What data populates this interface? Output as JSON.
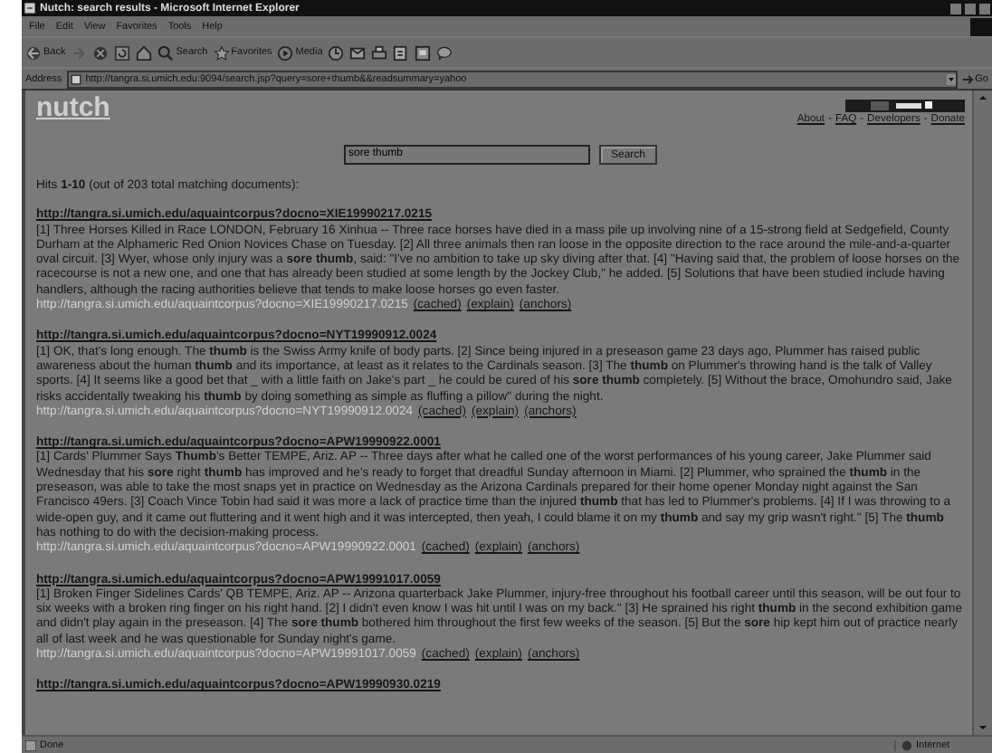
{
  "window": {
    "title": "Nutch: search results - Microsoft Internet Explorer"
  },
  "menu": [
    "File",
    "Edit",
    "View",
    "Favorites",
    "Tools",
    "Help"
  ],
  "toolbar": [
    {
      "kind": "back",
      "label": "Back"
    },
    {
      "kind": "forward"
    },
    {
      "kind": "stop"
    },
    {
      "kind": "refresh"
    },
    {
      "kind": "home"
    },
    {
      "kind": "search",
      "label": "Search"
    },
    {
      "kind": "favorites",
      "label": "Favorites"
    },
    {
      "kind": "media",
      "label": "Media"
    },
    {
      "kind": "history"
    },
    {
      "kind": "mail"
    },
    {
      "kind": "print"
    },
    {
      "kind": "edit"
    },
    {
      "kind": "discuss"
    },
    {
      "kind": "messenger"
    }
  ],
  "address": {
    "label": "Address",
    "value": "http://tangra.si.umich.edu:9094/search.jsp?query=sore+thumb&&readsummary=yahoo",
    "go": "Go"
  },
  "page": {
    "logo": "nutch",
    "nav": [
      {
        "kind": "link",
        "label": "About"
      },
      {
        "kind": "separator",
        "label": "-"
      },
      {
        "kind": "link",
        "label": "FAQ"
      },
      {
        "kind": "separator",
        "label": "-"
      },
      {
        "kind": "link",
        "label": "Developers"
      },
      {
        "kind": "separator",
        "label": "-"
      },
      {
        "kind": "link",
        "label": "Donate"
      }
    ],
    "search": {
      "value": "sore thumb",
      "button": "Search"
    },
    "hits": "Hits **1-10** (out of 203 total matching documents):",
    "results": [
      {
        "title": "http://tangra.si.umich.edu/aquaintcorpus?docno=XIE19990217.0215",
        "snippet": "[1] Three Horses Killed in Race LONDON, February 16 Xinhua -- Three race horses have died in a mass pile up involving nine of a 15-strong field at Sedgefield, County Durham at the Alphameric Red Onion Novices Chase on Tuesday. [2] All three animals then ran loose in the opposite direction to the race around the mile-and-a-quarter oval circuit. [3] Wyer, whose only injury was a **sore thumb**, said: \"I've no ambition to take up sky diving after that. [4] \"Having said that, the problem of loose horses on the racecourse is not a new one, and one that has already been studied at some length by the Jockey Club,\" he added. [5] Solutions that have been studied include having handlers, although the racing authorities believe that tends to make loose horses go even faster.",
        "url": "http://tangra.si.umich.edu/aquaintcorpus?docno=XIE19990217.0215",
        "links": [
          "(cached)",
          "(explain)",
          "(anchors)"
        ]
      },
      {
        "title": "http://tangra.si.umich.edu/aquaintcorpus?docno=NYT19990912.0024",
        "snippet": "[1] OK, that's long enough. The **thumb** is the Swiss Army knife of body parts. [2] Since being injured in a preseason game 23 days ago, Plummer has raised public awareness about the human **thumb** and its importance, at least as it relates to the Cardinals season. [3] The **thumb** on Plummer's throwing hand is the talk of Valley sports. [4] It seems like a good bet that _ with a little faith on Jake's part _ he could be cured of his **sore thumb** completely. [5] Without the brace, Omohundro said, Jake risks accidentally tweaking his **thumb** by doing something as simple as fluffing a pillow\" during the night.",
        "url": "http://tangra.si.umich.edu/aquaintcorpus?docno=NYT19990912.0024",
        "links": [
          "(cached)",
          "(explain)",
          "(anchors)"
        ]
      },
      {
        "title": "http://tangra.si.umich.edu/aquaintcorpus?docno=APW19990922.0001",
        "snippet": "[1] Cards' Plummer Says **Thumb**'s Better TEMPE, Ariz. AP -- Three days after what he called one of the worst performances of his young career, Jake Plummer said Wednesday that his **sore** right **thumb** has improved and he's ready to forget that dreadful Sunday afternoon in Miami. [2] Plummer, who sprained the **thumb** in the preseason, was able to take the most snaps yet in practice on Wednesday as the Arizona Cardinals prepared for their home opener Monday night against the San Francisco 49ers. [3] Coach Vince Tobin had said it was more a lack of practice time than the injured **thumb** that has led to Plummer's problems. [4] If I was throwing to a wide-open guy, and it came out fluttering and it went high and it was intercepted, then yeah, I could blame it on my **thumb** and say my grip wasn't right.\" [5] The **thumb** has nothing to do with the decision-making process.",
        "url": "http://tangra.si.umich.edu/aquaintcorpus?docno=APW19990922.0001",
        "links": [
          "(cached)",
          "(explain)",
          "(anchors)"
        ]
      },
      {
        "title": "http://tangra.si.umich.edu/aquaintcorpus?docno=APW19991017.0059",
        "snippet": "[1] Broken Finger Sidelines Cards' QB TEMPE, Ariz. AP -- Arizona quarterback Jake Plummer, injury-free throughout his football career until this season, will be out four to six weeks with a broken ring finger on his right hand. [2] I didn't even know I was hit until I was on my back.\" [3] He sprained his right **thumb** in the second exhibition game and didn't play again in the preseason. [4] The **sore thumb** bothered him throughout the first few weeks of the season. [5] But the **sore** hip kept him out of practice nearly all of last week and he was questionable for Sunday night's game.",
        "url": "http://tangra.si.umich.edu/aquaintcorpus?docno=APW19991017.0059",
        "links": [
          "(cached)",
          "(explain)",
          "(anchors)"
        ]
      },
      {
        "title": "http://tangra.si.umich.edu/aquaintcorpus?docno=APW19990930.0219"
      }
    ]
  },
  "status": {
    "text": "Done",
    "zone": "Internet"
  }
}
